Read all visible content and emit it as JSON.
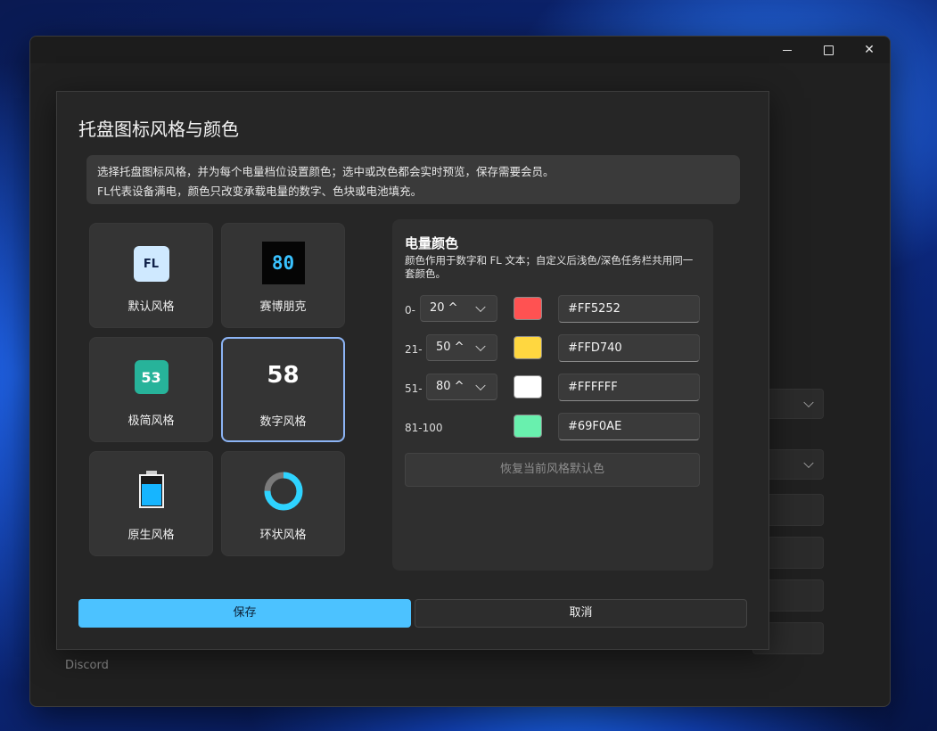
{
  "window": {
    "controls": {
      "minimize": "minimize-icon",
      "maximize": "maximize-icon",
      "close": "close-icon"
    },
    "background_item": "Discord"
  },
  "dialog": {
    "title": "托盘图标风格与颜色",
    "info_line1": "选择托盘图标风格，并为每个电量档位设置颜色；选中或改色都会实时预览，保存需要会员。",
    "info_line2": "FL代表设备满电，颜色只改变承载电量的数字、色块或电池填充。",
    "styles": [
      {
        "label": "默认风格",
        "icon_text": "FL",
        "selected": false
      },
      {
        "label": "赛博朋克",
        "icon_text": "80",
        "selected": false
      },
      {
        "label": "极简风格",
        "icon_text": "53",
        "selected": false
      },
      {
        "label": "数字风格",
        "icon_text": "58",
        "selected": true
      },
      {
        "label": "原生风格",
        "icon": "battery-icon",
        "selected": false
      },
      {
        "label": "环状风格",
        "icon": "ring-icon",
        "selected": false
      }
    ],
    "panel": {
      "title": "电量颜色",
      "description": "颜色作用于数字和 FL 文本；自定义后浅色/深色任务栏共用同一套颜色。",
      "rows": [
        {
          "range": "0-",
          "select": "20",
          "color": "#FF5252",
          "hex": "#FF5252"
        },
        {
          "range": "21-",
          "select": "50",
          "color": "#FFD740",
          "hex": "#FFD740"
        },
        {
          "range": "51-",
          "select": "80",
          "color": "#FFFFFF",
          "hex": "#FFFFFF"
        },
        {
          "range": "81-100",
          "select": "",
          "color": "#69F0AE",
          "hex": "#69F0AE"
        }
      ],
      "reset_label": "恢复当前风格默认色"
    },
    "save_label": "保存",
    "cancel_label": "取消"
  },
  "colors": {
    "accent": "#4CC2FF",
    "selected_border": "#8CB4F5"
  }
}
